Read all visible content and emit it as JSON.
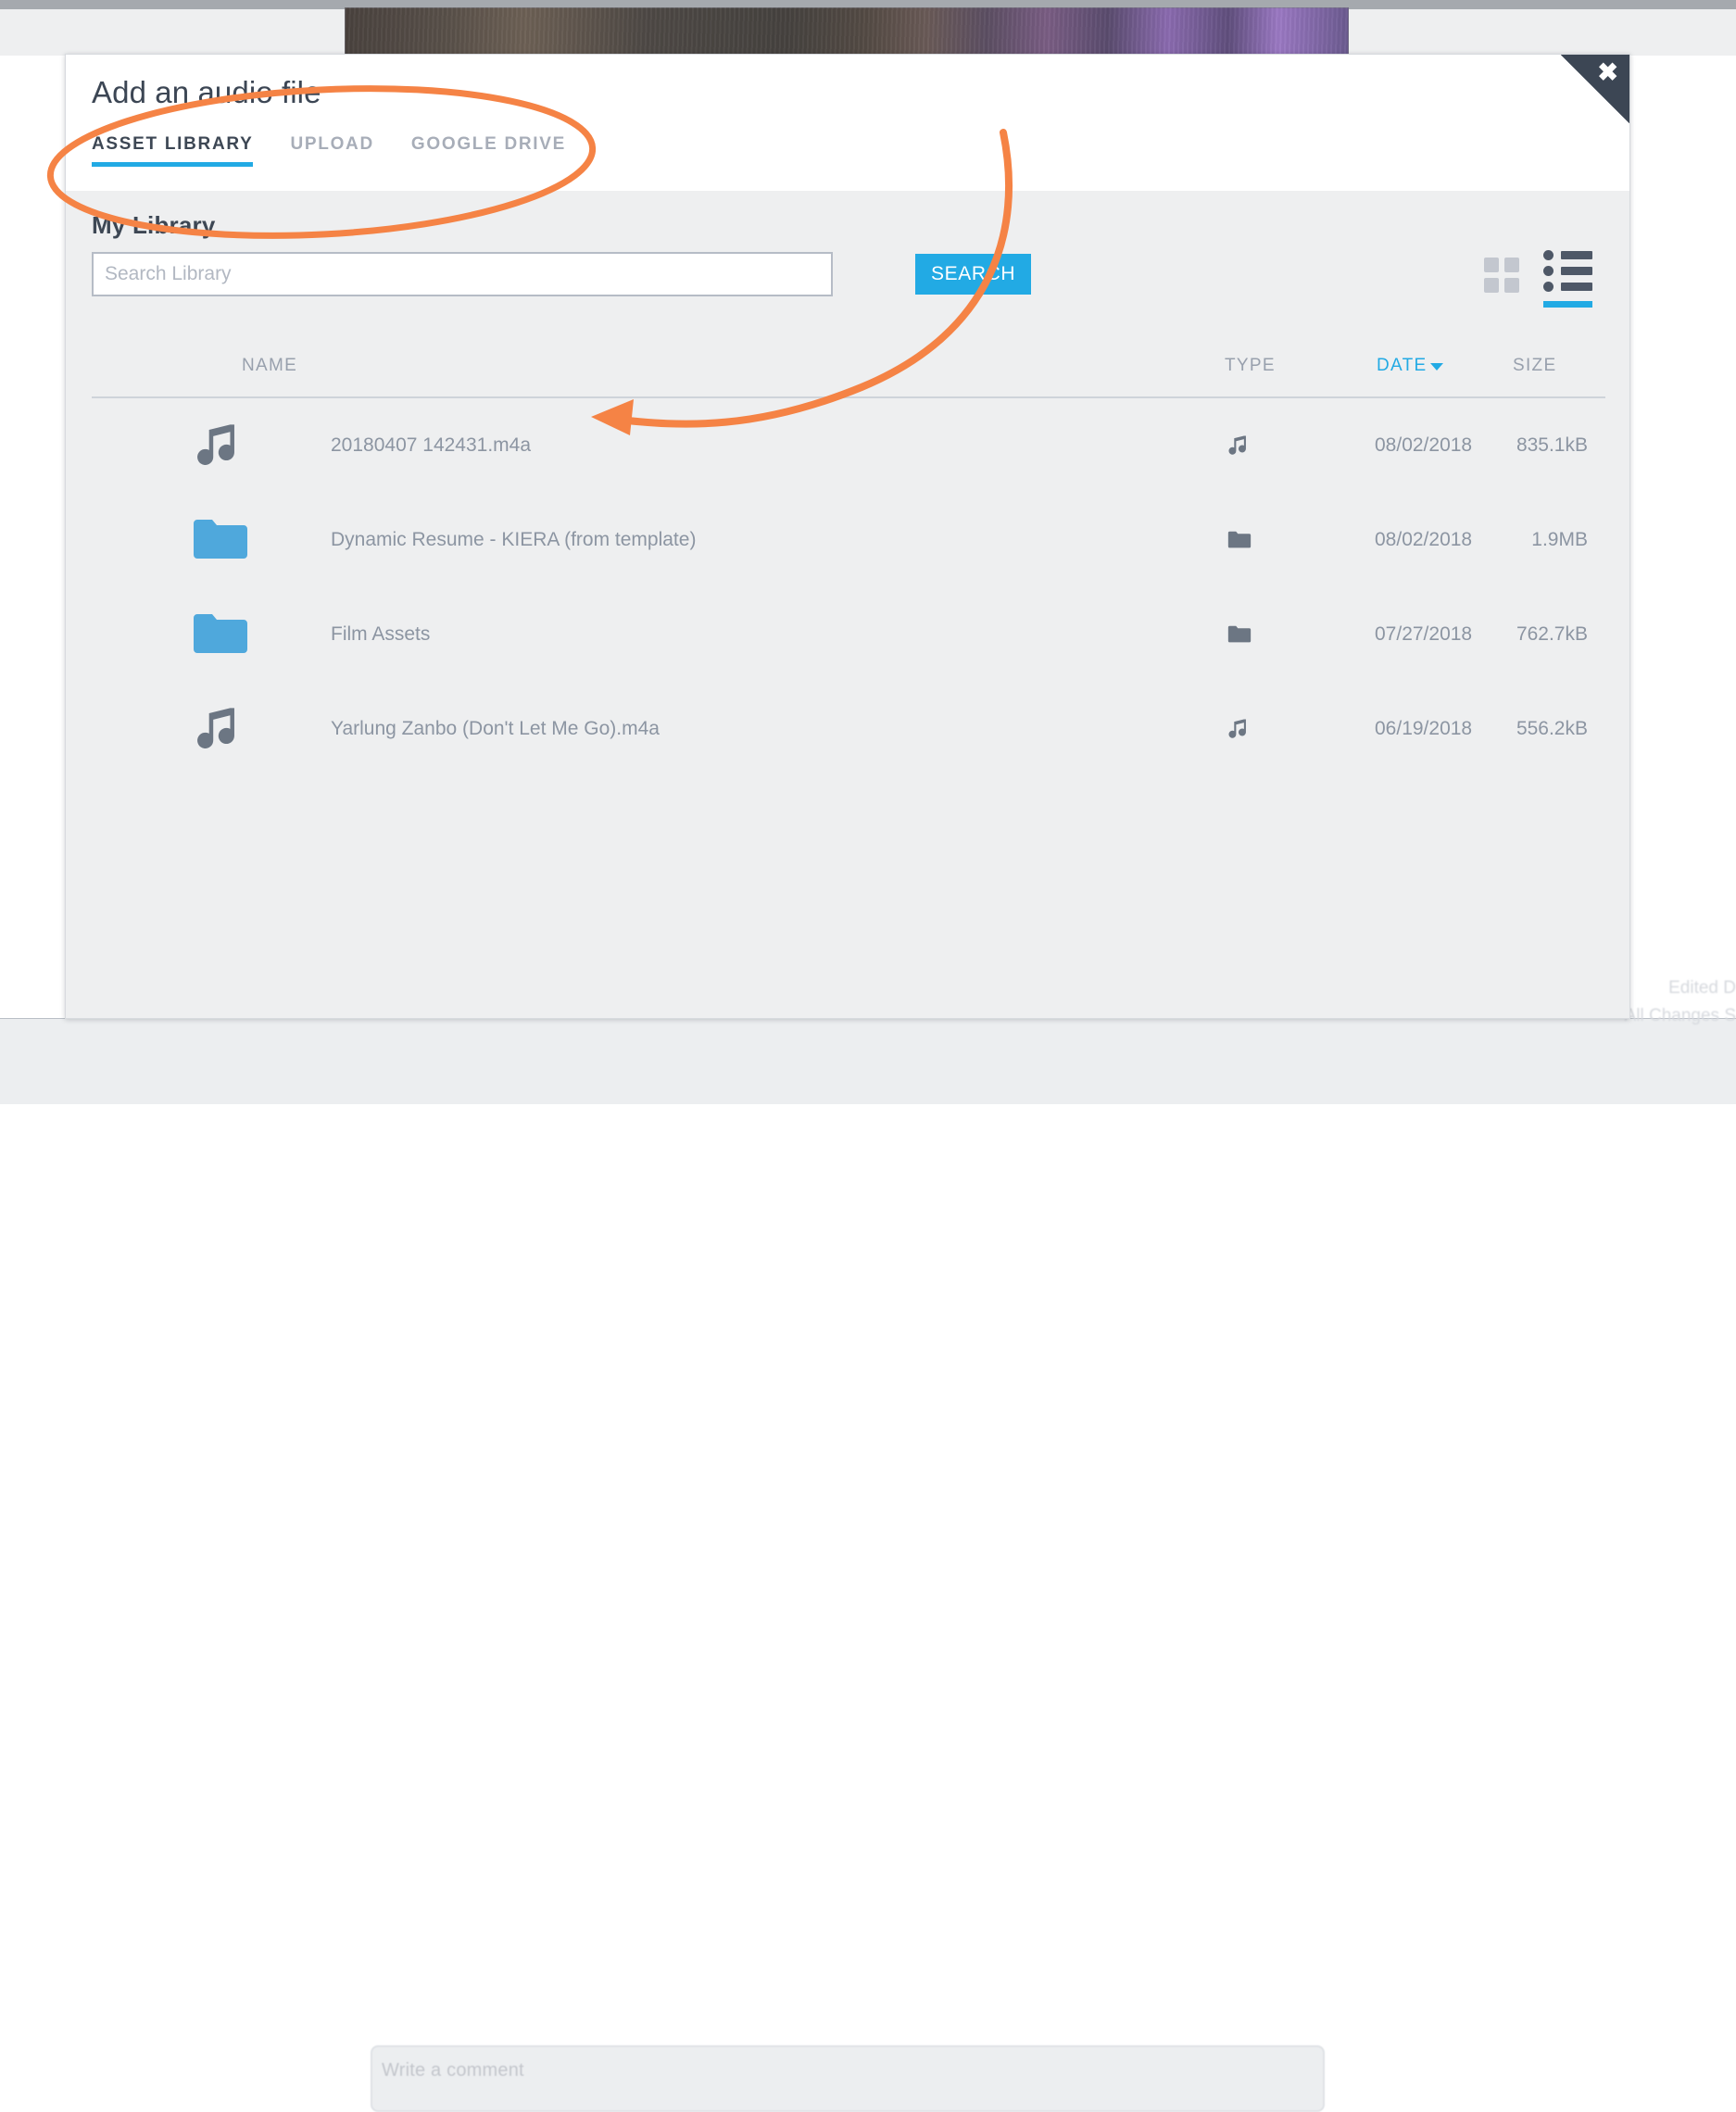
{
  "modal": {
    "title": "Add an audio file",
    "close_label": "✖",
    "tabs": [
      {
        "label": "ASSET LIBRARY",
        "active": true
      },
      {
        "label": "UPLOAD",
        "active": false
      },
      {
        "label": "GOOGLE DRIVE",
        "active": false
      }
    ],
    "section_title": "My Library",
    "search": {
      "placeholder": "Search Library",
      "value": "",
      "button_label": "SEARCH"
    },
    "view_modes": {
      "grid_label": "grid-view",
      "list_label": "list-view",
      "active": "list-view"
    },
    "table": {
      "columns": [
        "NAME",
        "TYPE",
        "DATE",
        "SIZE"
      ],
      "sorted_column": "DATE",
      "sort_direction": "descending",
      "rows": [
        {
          "icon": "music-note-icon",
          "name": "20180407 142431.m4a",
          "type": "audio",
          "date": "08/02/2018",
          "size": "835.1kB"
        },
        {
          "icon": "folder-icon",
          "name": "Dynamic Resume - KIERA (from template)",
          "type": "folder",
          "date": "08/02/2018",
          "size": "1.9MB"
        },
        {
          "icon": "folder-icon",
          "name": "Film Assets",
          "type": "folder",
          "date": "07/27/2018",
          "size": "762.7kB"
        },
        {
          "icon": "music-note-icon",
          "name": "Yarlung Zanbo (Don't Let Me Go).m4a",
          "type": "audio",
          "date": "06/19/2018",
          "size": "556.2kB"
        }
      ]
    }
  },
  "background": {
    "comment_placeholder": "Write a comment",
    "status_line_1": "Edited D",
    "status_line_2": "All Changes S"
  },
  "colors": {
    "accent_blue": "#22aae4",
    "annotation_orange": "#f58345",
    "dark_slate": "#3c4654",
    "muted_text": "#8c95a2",
    "folder_blue": "#4fa8dc",
    "panel_gray": "#eeeff0"
  }
}
